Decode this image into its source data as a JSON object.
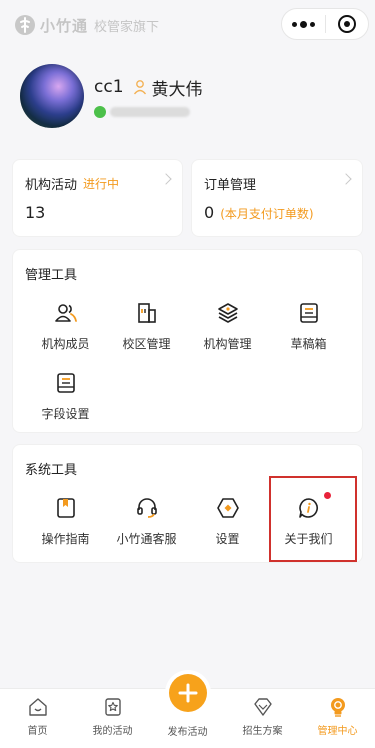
{
  "brand": {
    "name": "小竹通",
    "sub": "校管家旗下"
  },
  "profile": {
    "nickname": "cc1",
    "real_name": "黄大伟"
  },
  "stats": [
    {
      "title": "机构活动",
      "tag": "进行中",
      "value": "13",
      "note": ""
    },
    {
      "title": "订单管理",
      "tag": "",
      "value": "0",
      "note": "(本月支付订单数)"
    }
  ],
  "manage_tools": {
    "title": "管理工具",
    "items": [
      {
        "label": "机构成员",
        "icon": "members-icon"
      },
      {
        "label": "校区管理",
        "icon": "campus-icon"
      },
      {
        "label": "机构管理",
        "icon": "layers-icon"
      },
      {
        "label": "草稿箱",
        "icon": "drafts-icon"
      },
      {
        "label": "字段设置",
        "icon": "field-settings-icon"
      }
    ]
  },
  "system_tools": {
    "title": "系统工具",
    "items": [
      {
        "label": "操作指南",
        "icon": "guide-icon"
      },
      {
        "label": "小竹通客服",
        "icon": "headset-icon"
      },
      {
        "label": "设置",
        "icon": "hexagon-settings-icon"
      },
      {
        "label": "关于我们",
        "icon": "info-chat-icon",
        "badge": true
      }
    ]
  },
  "tabbar": [
    {
      "label": "首页",
      "icon": "home-icon",
      "active": false
    },
    {
      "label": "我的活动",
      "icon": "star-doc-icon",
      "active": false
    },
    {
      "label": "发布活动",
      "icon": "plus-icon",
      "active": false
    },
    {
      "label": "招生方案",
      "icon": "diamond-icon",
      "active": false
    },
    {
      "label": "管理中心",
      "icon": "bulb-icon",
      "active": true
    }
  ],
  "colors": {
    "accent": "#f39a1e",
    "badge": "#e8223a",
    "highlight": "#d0312d"
  }
}
